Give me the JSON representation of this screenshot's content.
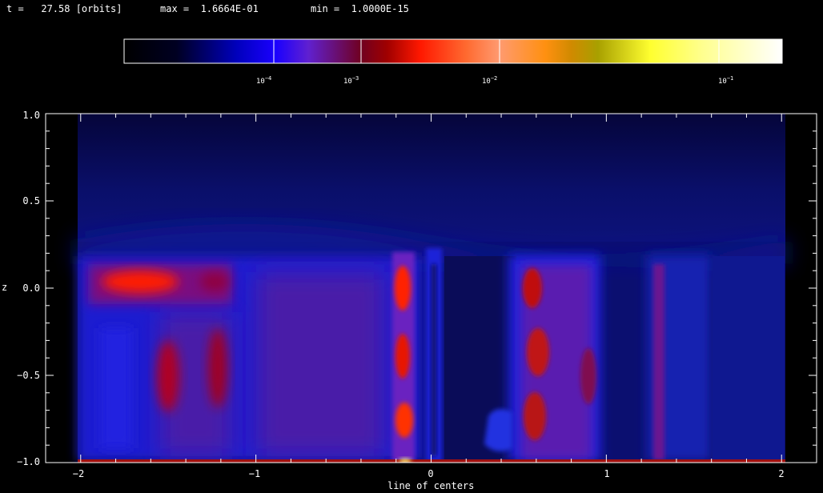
{
  "header": {
    "time_label": "t =   27.58 [orbits]",
    "max_label": "max =  1.6664E-01",
    "min_label": "min =  1.0000E-15"
  },
  "colorbar": {
    "ticks": [
      {
        "base": "10",
        "exp": "−4"
      },
      {
        "base": "10",
        "exp": "−3"
      },
      {
        "base": "10",
        "exp": "−2"
      },
      {
        "base": "10",
        "exp": "−1"
      }
    ]
  },
  "chart_data": {
    "type": "heatmap",
    "title": "",
    "xlabel": "line of centers",
    "ylabel": "z",
    "xlim": [
      -2.2,
      2.2
    ],
    "ylim": [
      -1.0,
      1.0
    ],
    "xticks": [
      -2,
      -1,
      0,
      1,
      2
    ],
    "xtick_labels": [
      "−2",
      "−1",
      "0",
      "1",
      "2"
    ],
    "yticks": [
      -1.0,
      -0.5,
      0.0,
      0.5,
      1.0
    ],
    "ytick_labels": [
      "−1.0",
      "−0.5",
      "0.0",
      "0.5",
      "1.0"
    ],
    "colorscale": "log",
    "vmin": 1e-15,
    "vmax": 0.16664,
    "colorbar_ticks": [
      0.0001,
      0.001,
      0.01,
      0.1
    ],
    "grid": false
  }
}
